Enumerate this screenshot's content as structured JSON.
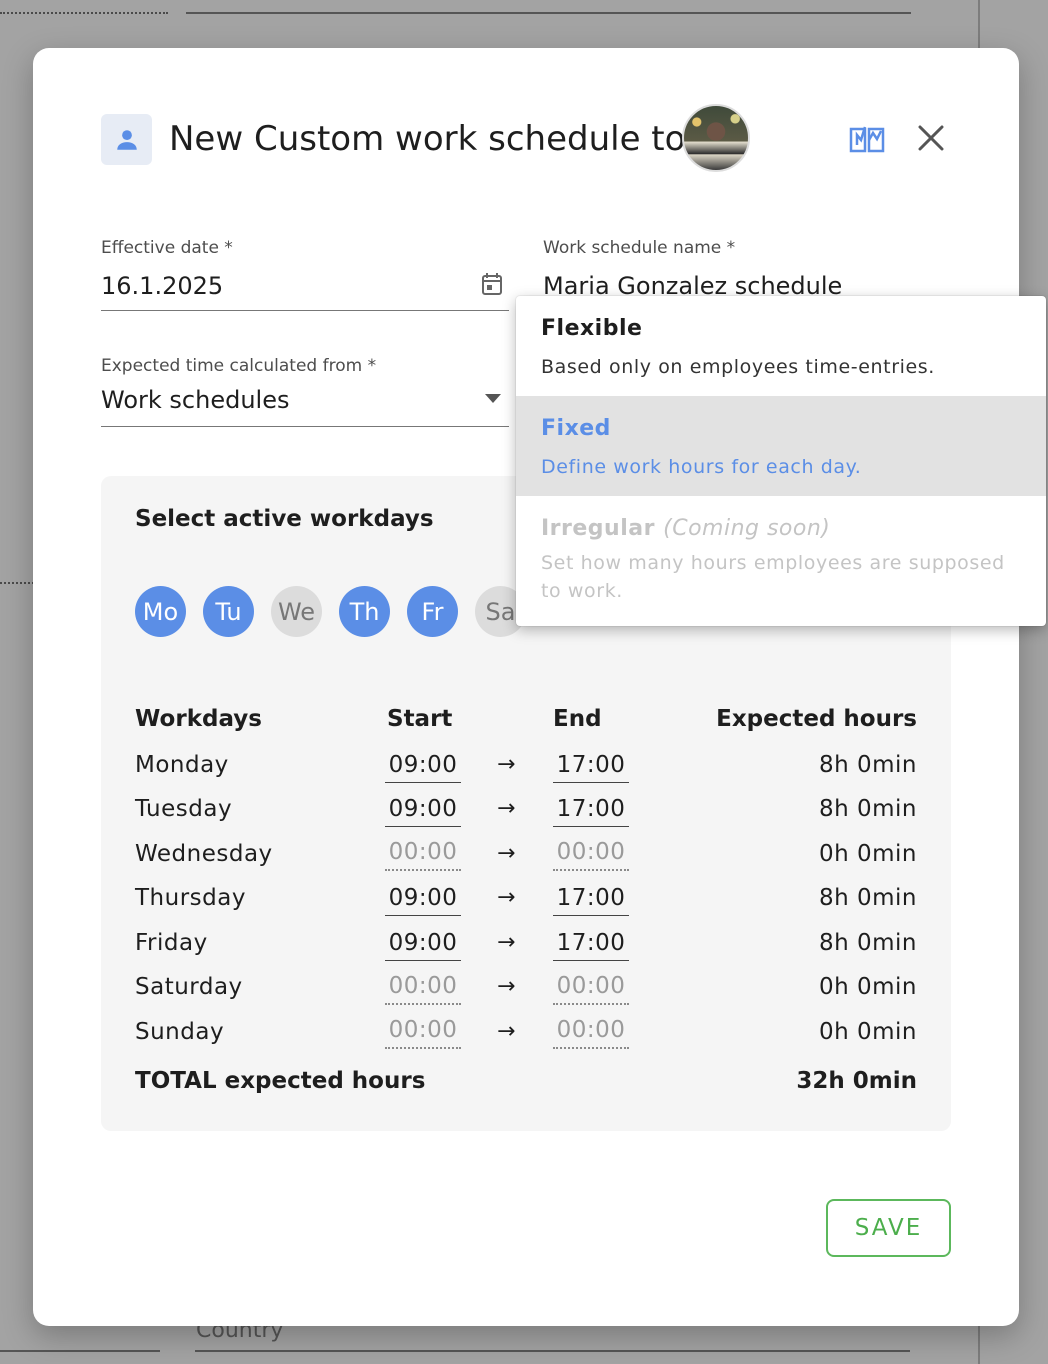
{
  "background": {
    "country_label": "Country"
  },
  "modal": {
    "title": "New Custom work schedule to",
    "save_label": "SAVE"
  },
  "fields": {
    "effective_date": {
      "label": "Effective date *",
      "value": "16.1.2025"
    },
    "schedule_name": {
      "label": "Work schedule name *",
      "value": "Maria Gonzalez schedule"
    },
    "expected_from": {
      "label": "Expected time calculated from *",
      "value": "Work schedules"
    }
  },
  "workdays": {
    "title": "Select active workdays",
    "chips": [
      {
        "label": "Mo",
        "active": true
      },
      {
        "label": "Tu",
        "active": true
      },
      {
        "label": "We",
        "active": false
      },
      {
        "label": "Th",
        "active": true
      },
      {
        "label": "Fr",
        "active": true
      },
      {
        "label": "Sa",
        "active": false
      }
    ],
    "headers": {
      "day": "Workdays",
      "start": "Start",
      "end": "End",
      "hours": "Expected hours"
    },
    "arrow": "→",
    "rows": [
      {
        "day": "Monday",
        "start": "09:00",
        "end": "17:00",
        "hours": "8h 0min",
        "active": true
      },
      {
        "day": "Tuesday",
        "start": "09:00",
        "end": "17:00",
        "hours": "8h 0min",
        "active": true
      },
      {
        "day": "Wednesday",
        "start": "00:00",
        "end": "00:00",
        "hours": "0h 0min",
        "active": false
      },
      {
        "day": "Thursday",
        "start": "09:00",
        "end": "17:00",
        "hours": "8h 0min",
        "active": true
      },
      {
        "day": "Friday",
        "start": "09:00",
        "end": "17:00",
        "hours": "8h 0min",
        "active": true
      },
      {
        "day": "Saturday",
        "start": "00:00",
        "end": "00:00",
        "hours": "0h 0min",
        "active": false
      },
      {
        "day": "Sunday",
        "start": "00:00",
        "end": "00:00",
        "hours": "0h 0min",
        "active": false
      }
    ],
    "total_label": "TOTAL expected hours",
    "total_value": "32h 0min"
  },
  "schedule_type_menu": {
    "options": [
      {
        "title": "Flexible",
        "description": "Based only on employees time-entries.",
        "state": "normal"
      },
      {
        "title": "Fixed",
        "description": "Define work hours for each day.",
        "state": "highlighted"
      },
      {
        "title": "Irregular",
        "suffix": "(Coming soon)",
        "description": "Set how many hours employees are supposed to work.",
        "state": "disabled"
      }
    ]
  },
  "colors": {
    "accent_blue": "#5b8ee6",
    "save_green": "#4cae4c",
    "chip_inactive": "#dcdcdc",
    "menu_highlight": "#e2e2e2"
  },
  "icons": [
    "person-icon",
    "calendar-icon",
    "dropdown-arrow-icon",
    "book-open-icon",
    "close-icon",
    "right-arrow-icon"
  ]
}
